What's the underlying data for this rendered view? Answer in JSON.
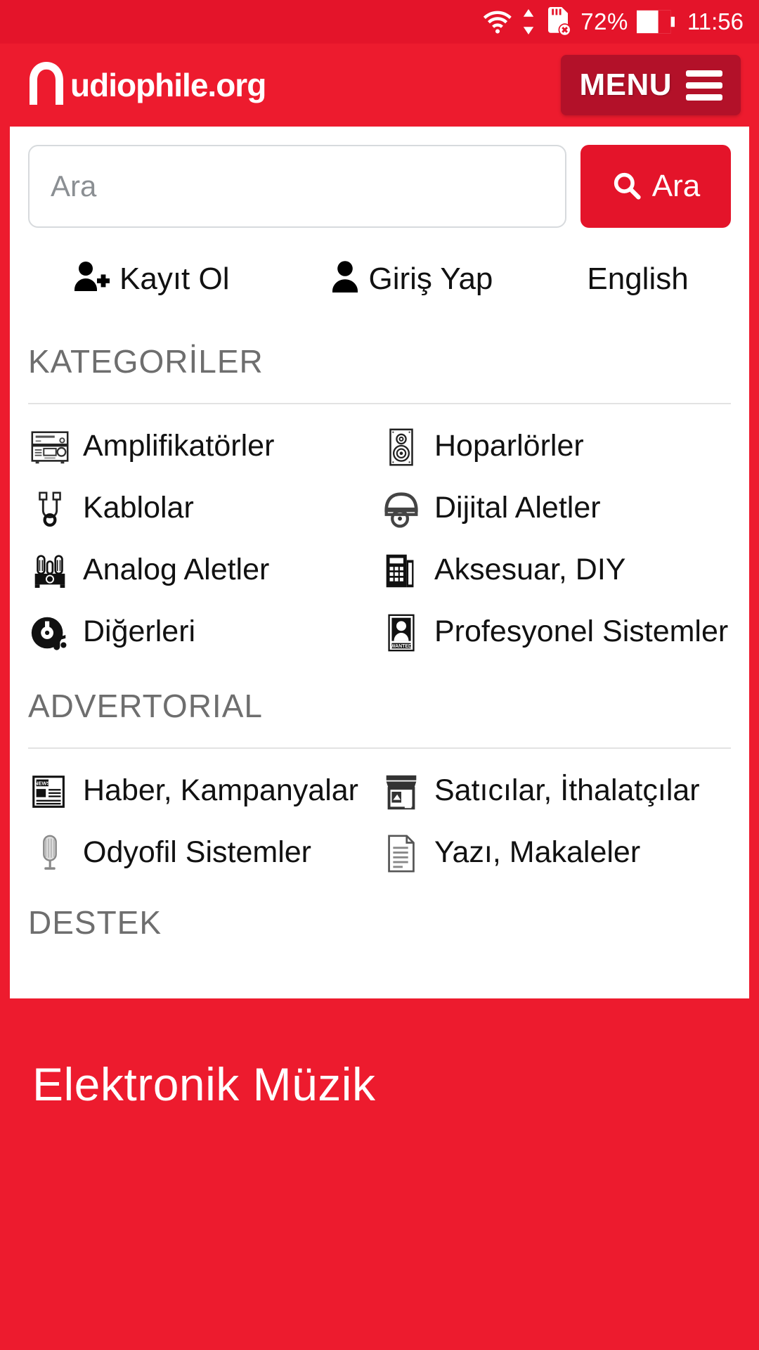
{
  "status_bar": {
    "wifi_icon": "wifi-icon",
    "data_arrows_icon": "data-transfer-arrows-icon",
    "sdcard_icon": "sdcard-error-icon",
    "battery_percent": "72%",
    "battery_icon": "battery-icon",
    "battery_level": 72,
    "time": "11:56"
  },
  "header": {
    "logo_text": "udiophile.org",
    "logo_icon": "headphone-a-logo-icon",
    "menu_label": "MENU",
    "menu_icon": "hamburger-icon",
    "bg_color": "#ed1b2e",
    "menu_bg_color": "#b31129"
  },
  "search": {
    "placeholder": "Ara",
    "value": "",
    "button_label": "Ara",
    "button_icon": "search-icon",
    "button_color": "#e4142a"
  },
  "account": {
    "register_label": "Kayıt Ol",
    "register_icon": "user-plus-icon",
    "login_label": "Giriş Yap",
    "login_icon": "user-icon",
    "language_label": "English"
  },
  "sections": [
    {
      "id": "kategoriler",
      "heading": "KATEGORİLER",
      "items": [
        {
          "label": "Amplifikatörler",
          "icon": "amplifier-icon"
        },
        {
          "label": "Hoparlörler",
          "icon": "speaker-icon"
        },
        {
          "label": "Kablolar",
          "icon": "cable-icon"
        },
        {
          "label": "Dijital Aletler",
          "icon": "cd-player-icon"
        },
        {
          "label": "Analog Aletler",
          "icon": "tube-amp-icon"
        },
        {
          "label": "Aksesuar, DIY",
          "icon": "calculator-icon"
        },
        {
          "label": "Diğerleri",
          "icon": "vinyl-music-icon"
        },
        {
          "label": "Profesyonel Sistemler",
          "icon": "wanted-poster-icon"
        }
      ]
    },
    {
      "id": "advertorial",
      "heading": "ADVERTORIAL",
      "items": [
        {
          "label": "Haber, Kampanyalar",
          "icon": "newspaper-icon"
        },
        {
          "label": "Satıcılar, İthalatçılar",
          "icon": "shop-icon"
        },
        {
          "label": "Odyofil Sistemler",
          "icon": "microphone-icon"
        },
        {
          "label": "Yazı, Makaleler",
          "icon": "document-icon"
        }
      ]
    },
    {
      "id": "destek",
      "heading": "DESTEK",
      "items": []
    }
  ],
  "footer": {
    "title": "Elektronik Müzik"
  }
}
